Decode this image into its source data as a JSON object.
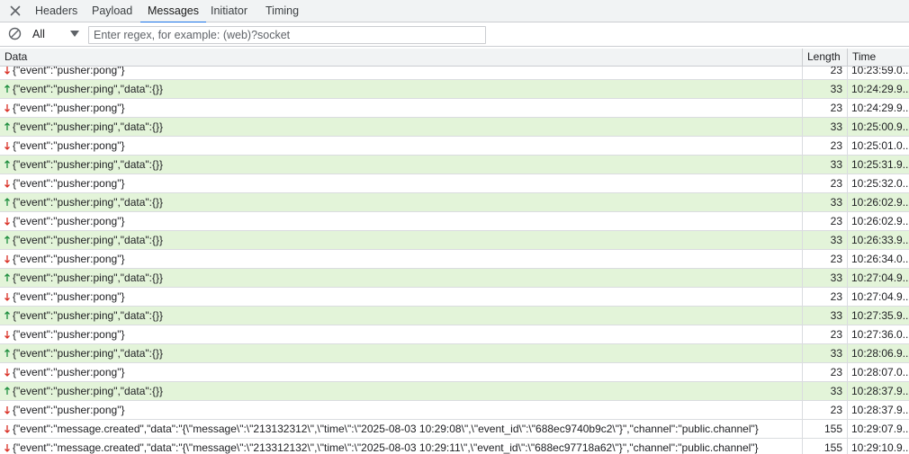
{
  "tabs": [
    {
      "label": "Headers",
      "active": false
    },
    {
      "label": "Payload",
      "active": false
    },
    {
      "label": "Messages",
      "active": true
    },
    {
      "label": "Initiator",
      "active": false
    },
    {
      "label": "Timing",
      "active": false
    }
  ],
  "icons": {
    "close": "close-icon",
    "block": "block-icon",
    "dropdown": "caret-down-icon",
    "sent": "arrow-up-icon",
    "received": "arrow-down-icon"
  },
  "filter": {
    "type_value": "All",
    "regex_placeholder": "Enter regex, for example: (web)?socket",
    "regex_value": ""
  },
  "columns": {
    "data": "Data",
    "length": "Length",
    "time": "Time"
  },
  "colors": {
    "sent_row_bg": "#e3f4d9",
    "sent_arrow": "#1e8e3e",
    "received_arrow": "#d93025",
    "active_tab": "#1a73e8"
  },
  "messages": [
    {
      "direction": "received",
      "data": "{\"event\":\"pusher:pong\"}",
      "length": "23",
      "time": "10:23:59.0..."
    },
    {
      "direction": "sent",
      "data": "{\"event\":\"pusher:ping\",\"data\":{}}",
      "length": "33",
      "time": "10:24:29.9..."
    },
    {
      "direction": "received",
      "data": "{\"event\":\"pusher:pong\"}",
      "length": "23",
      "time": "10:24:29.9..."
    },
    {
      "direction": "sent",
      "data": "{\"event\":\"pusher:ping\",\"data\":{}}",
      "length": "33",
      "time": "10:25:00.9..."
    },
    {
      "direction": "received",
      "data": "{\"event\":\"pusher:pong\"}",
      "length": "23",
      "time": "10:25:01.0..."
    },
    {
      "direction": "sent",
      "data": "{\"event\":\"pusher:ping\",\"data\":{}}",
      "length": "33",
      "time": "10:25:31.9..."
    },
    {
      "direction": "received",
      "data": "{\"event\":\"pusher:pong\"}",
      "length": "23",
      "time": "10:25:32.0..."
    },
    {
      "direction": "sent",
      "data": "{\"event\":\"pusher:ping\",\"data\":{}}",
      "length": "33",
      "time": "10:26:02.9..."
    },
    {
      "direction": "received",
      "data": "{\"event\":\"pusher:pong\"}",
      "length": "23",
      "time": "10:26:02.9..."
    },
    {
      "direction": "sent",
      "data": "{\"event\":\"pusher:ping\",\"data\":{}}",
      "length": "33",
      "time": "10:26:33.9..."
    },
    {
      "direction": "received",
      "data": "{\"event\":\"pusher:pong\"}",
      "length": "23",
      "time": "10:26:34.0..."
    },
    {
      "direction": "sent",
      "data": "{\"event\":\"pusher:ping\",\"data\":{}}",
      "length": "33",
      "time": "10:27:04.9..."
    },
    {
      "direction": "received",
      "data": "{\"event\":\"pusher:pong\"}",
      "length": "23",
      "time": "10:27:04.9..."
    },
    {
      "direction": "sent",
      "data": "{\"event\":\"pusher:ping\",\"data\":{}}",
      "length": "33",
      "time": "10:27:35.9..."
    },
    {
      "direction": "received",
      "data": "{\"event\":\"pusher:pong\"}",
      "length": "23",
      "time": "10:27:36.0..."
    },
    {
      "direction": "sent",
      "data": "{\"event\":\"pusher:ping\",\"data\":{}}",
      "length": "33",
      "time": "10:28:06.9..."
    },
    {
      "direction": "received",
      "data": "{\"event\":\"pusher:pong\"}",
      "length": "23",
      "time": "10:28:07.0..."
    },
    {
      "direction": "sent",
      "data": "{\"event\":\"pusher:ping\",\"data\":{}}",
      "length": "33",
      "time": "10:28:37.9..."
    },
    {
      "direction": "received",
      "data": "{\"event\":\"pusher:pong\"}",
      "length": "23",
      "time": "10:28:37.9..."
    },
    {
      "direction": "received",
      "data": "{\"event\":\"message.created\",\"data\":\"{\\\"message\\\":\\\"213132312\\\",\\\"time\\\":\\\"2025-08-03 10:29:08\\\",\\\"event_id\\\":\\\"688ec9740b9c2\\\"}\",\"channel\":\"public.channel\"}",
      "length": "155",
      "time": "10:29:07.9..."
    },
    {
      "direction": "received",
      "data": "{\"event\":\"message.created\",\"data\":\"{\\\"message\\\":\\\"213312132\\\",\\\"time\\\":\\\"2025-08-03 10:29:11\\\",\\\"event_id\\\":\\\"688ec97718a62\\\"}\",\"channel\":\"public.channel\"}",
      "length": "155",
      "time": "10:29:10.9..."
    }
  ]
}
